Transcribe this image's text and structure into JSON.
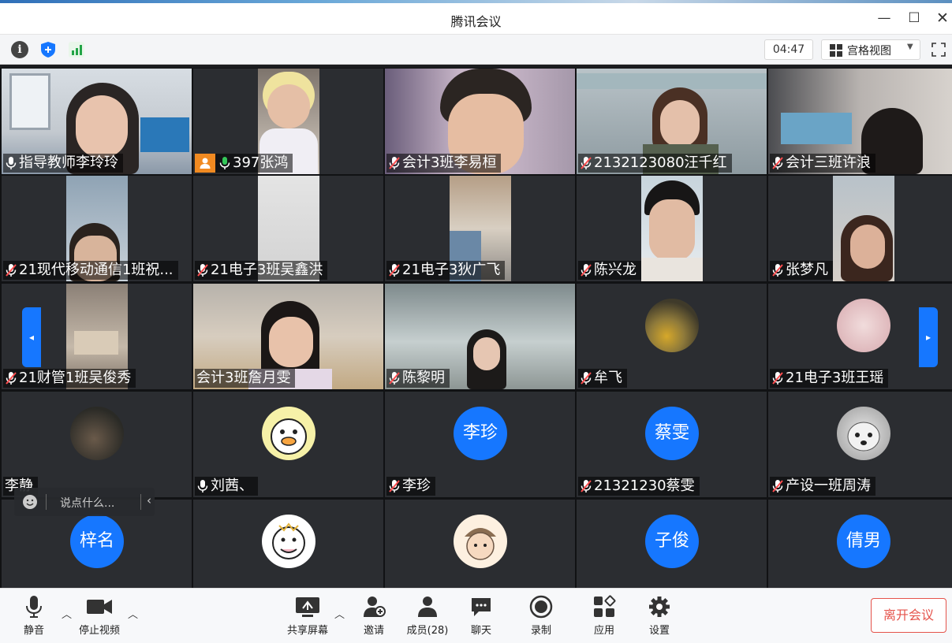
{
  "window": {
    "title": "腾讯会议"
  },
  "toolbar": {
    "timer": "04:47",
    "view_mode": "宫格视图"
  },
  "participants": [
    {
      "name": "指导教师李玲玲",
      "mic": "on"
    },
    {
      "name": "397张鸿",
      "mic": "on",
      "host": true
    },
    {
      "name": "会计3班李易桓",
      "mic": "muted"
    },
    {
      "name": "2132123080汪千红",
      "mic": "muted"
    },
    {
      "name": "会计三班许浪",
      "mic": "muted"
    },
    {
      "name": "21现代移动通信1班祝...",
      "mic": "muted"
    },
    {
      "name": "21电子3班吴鑫洪",
      "mic": "muted"
    },
    {
      "name": "21电子3狄广飞",
      "mic": "muted"
    },
    {
      "name": "陈兴龙",
      "mic": "muted"
    },
    {
      "name": "张梦凡",
      "mic": "muted"
    },
    {
      "name": "21财管1班吴俊秀",
      "mic": "muted"
    },
    {
      "name": "会计3班詹月雯",
      "mic": "none"
    },
    {
      "name": "陈黎明",
      "mic": "muted"
    },
    {
      "name": "牟飞",
      "mic": "muted"
    },
    {
      "name": "21电子3班王瑶",
      "mic": "muted"
    },
    {
      "name": "李静",
      "mic": "none"
    },
    {
      "name": "刘茜、",
      "mic": "on"
    },
    {
      "name": "李珍",
      "mic": "muted",
      "avatar_text": "李珍"
    },
    {
      "name": "21321230蔡雯",
      "mic": "muted",
      "avatar_text": "蔡雯"
    },
    {
      "name": "产设一班周涛",
      "mic": "muted"
    },
    {
      "name": "",
      "avatar_text": "梓名"
    },
    {
      "name": ""
    },
    {
      "name": ""
    },
    {
      "name": "",
      "avatar_text": "子俊"
    },
    {
      "name": "",
      "avatar_text": "倩男"
    }
  ],
  "chat": {
    "placeholder": "说点什么...",
    "collapse": "‹"
  },
  "nav": {
    "prev": "◂",
    "next": "▸"
  },
  "bottombar": {
    "mute": "静音",
    "stop_video": "停止视频",
    "share_screen": "共享屏幕",
    "invite": "邀请",
    "members": "成员(28)",
    "chat": "聊天",
    "record": "录制",
    "apps": "应用",
    "settings": "设置",
    "leave": "离开会议"
  },
  "colors": {
    "accent": "#1677ff",
    "leave": "#e5534b",
    "host": "#f18a21"
  }
}
